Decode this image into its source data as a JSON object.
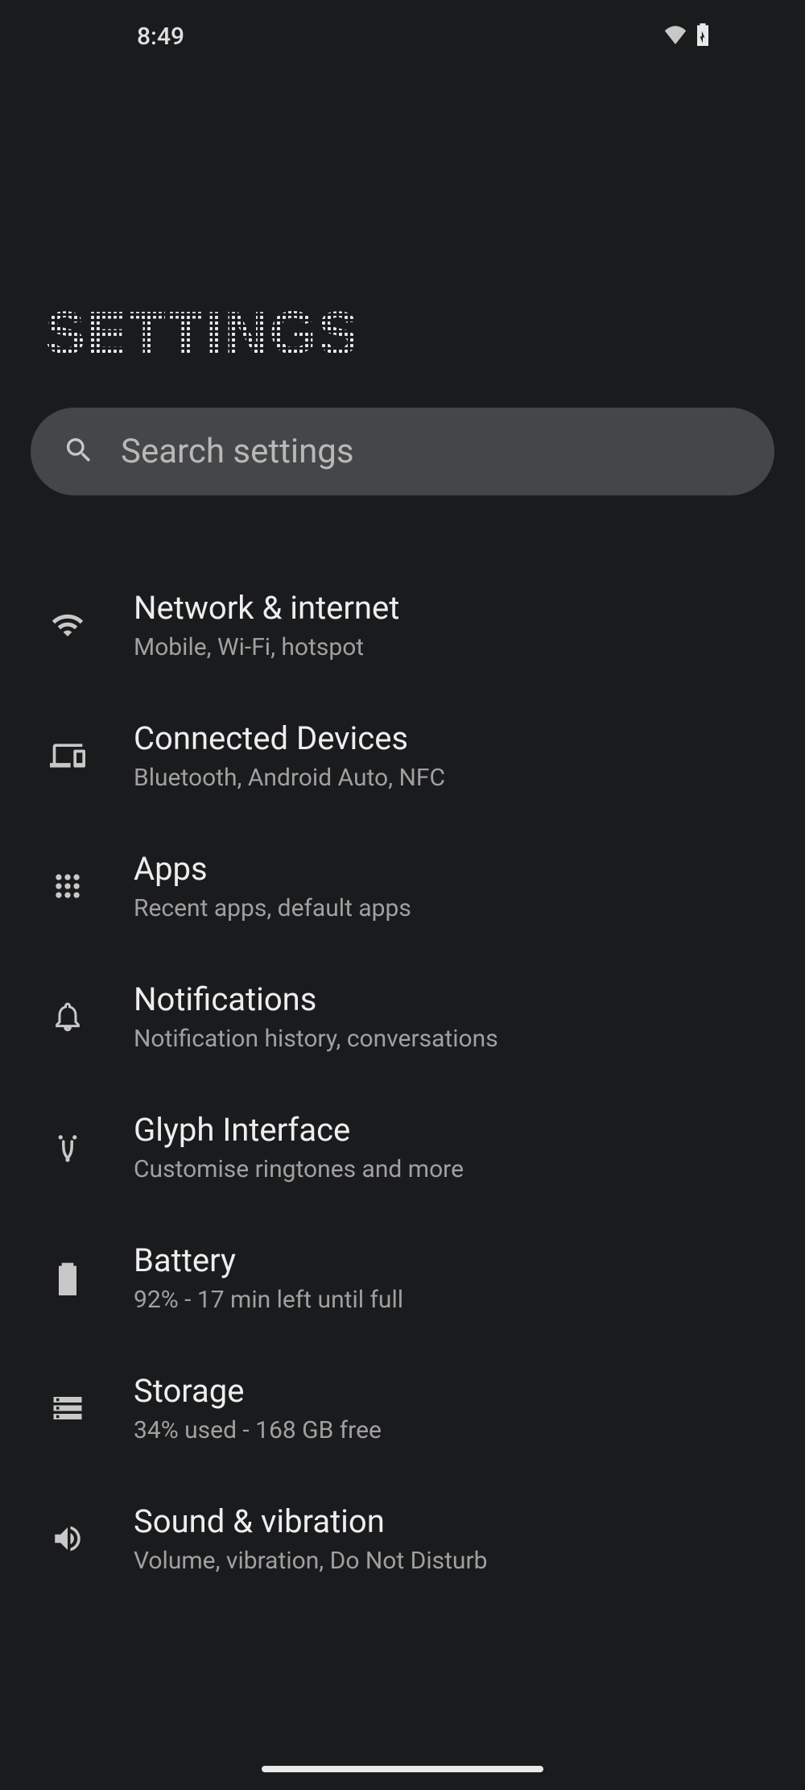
{
  "status": {
    "time": "8:49"
  },
  "header": {
    "title": "SETTINGS"
  },
  "search": {
    "placeholder": "Search settings"
  },
  "items": [
    {
      "title": "Network & internet",
      "subtitle": "Mobile, Wi-Fi, hotspot",
      "icon": "wifi-icon"
    },
    {
      "title": "Connected Devices",
      "subtitle": "Bluetooth, Android Auto, NFC",
      "icon": "devices-icon"
    },
    {
      "title": "Apps",
      "subtitle": "Recent apps, default apps",
      "icon": "apps-icon"
    },
    {
      "title": "Notifications",
      "subtitle": "Notification history, conversations",
      "icon": "bell-icon"
    },
    {
      "title": "Glyph Interface",
      "subtitle": "Customise ringtones and more",
      "icon": "glyph-icon"
    },
    {
      "title": "Battery",
      "subtitle": "92% - 17 min left until full",
      "icon": "battery-icon"
    },
    {
      "title": "Storage",
      "subtitle": "34% used - 168 GB free",
      "icon": "storage-icon"
    },
    {
      "title": "Sound & vibration",
      "subtitle": "Volume, vibration, Do Not Disturb",
      "icon": "sound-icon"
    }
  ]
}
